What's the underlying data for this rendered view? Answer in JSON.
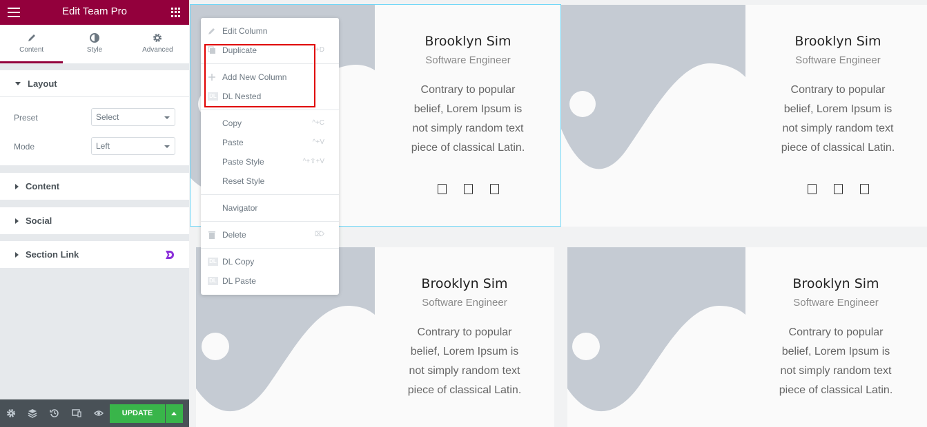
{
  "panel": {
    "title": "Edit Team Pro",
    "tabs": [
      {
        "label": "Content",
        "icon": "pencil-icon"
      },
      {
        "label": "Style",
        "icon": "half-circle-icon"
      },
      {
        "label": "Advanced",
        "icon": "gear-icon"
      }
    ],
    "sections": {
      "layout": {
        "title": "Layout",
        "preset_label": "Preset",
        "preset_value": "Select",
        "mode_label": "Mode",
        "mode_value": "Left"
      },
      "content": "Content",
      "social": "Social",
      "section_link": "Section Link"
    },
    "footer": {
      "update_label": "UPDATE"
    },
    "colors": {
      "header": "#93003c",
      "update": "#39b54a"
    }
  },
  "context_menu": {
    "items": [
      {
        "label": "Edit Column",
        "shortcut": "",
        "icon": "pencil-icon"
      },
      {
        "label": "Duplicate",
        "shortcut": "^+D",
        "icon": "copy-icon"
      },
      {
        "label": "Add New Column",
        "shortcut": "",
        "icon": "plus-icon"
      },
      {
        "label": "DL Nested",
        "shortcut": "",
        "icon": "dl-icon"
      },
      {
        "label": "Copy",
        "shortcut": "^+C",
        "icon": ""
      },
      {
        "label": "Paste",
        "shortcut": "^+V",
        "icon": ""
      },
      {
        "label": "Paste Style",
        "shortcut": "^+⇧+V",
        "icon": ""
      },
      {
        "label": "Reset Style",
        "shortcut": "",
        "icon": ""
      },
      {
        "label": "Navigator",
        "shortcut": "",
        "icon": ""
      },
      {
        "label": "Delete",
        "shortcut": "⌦",
        "icon": "trash-icon"
      },
      {
        "label": "DL Copy",
        "shortcut": "",
        "icon": "dl-icon"
      },
      {
        "label": "DL Paste",
        "shortcut": "",
        "icon": "dl-icon"
      }
    ]
  },
  "cards": [
    {
      "name": "Brooklyn Sim",
      "role": "Software Engineer",
      "description": "Contrary to popular belief, Lorem Ipsum is not simply random text piece of classical Latin."
    },
    {
      "name": "Brooklyn Sim",
      "role": "Software Engineer",
      "description": "Contrary to popular belief, Lorem Ipsum is not simply random text piece of classical Latin."
    },
    {
      "name": "Brooklyn Sim",
      "role": "Software Engineer",
      "description": "Contrary to popular belief, Lorem Ipsum is not simply random text piece of classical Latin."
    },
    {
      "name": "Brooklyn Sim",
      "role": "Software Engineer",
      "description": "Contrary to popular belief, Lorem Ipsum is not simply random text piece of classical Latin."
    }
  ]
}
